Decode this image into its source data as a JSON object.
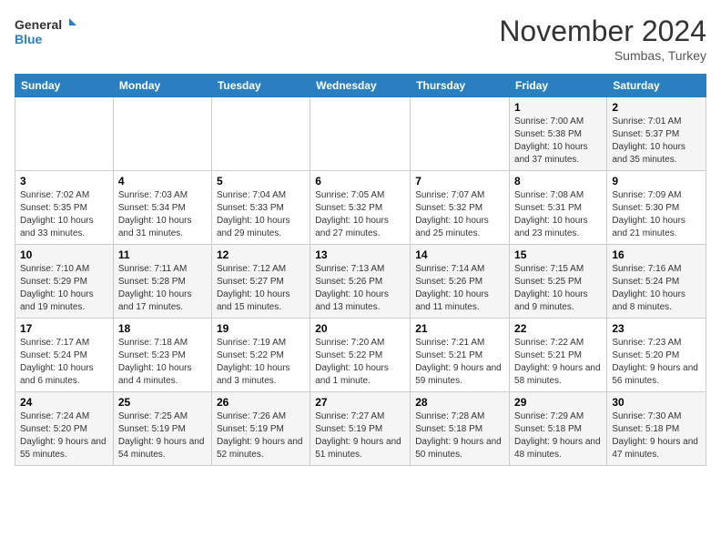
{
  "header": {
    "logo_line1": "General",
    "logo_line2": "Blue",
    "month_title": "November 2024",
    "subtitle": "Sumbas, Turkey"
  },
  "days_of_week": [
    "Sunday",
    "Monday",
    "Tuesday",
    "Wednesday",
    "Thursday",
    "Friday",
    "Saturday"
  ],
  "weeks": [
    [
      {
        "day": "",
        "info": ""
      },
      {
        "day": "",
        "info": ""
      },
      {
        "day": "",
        "info": ""
      },
      {
        "day": "",
        "info": ""
      },
      {
        "day": "",
        "info": ""
      },
      {
        "day": "1",
        "info": "Sunrise: 7:00 AM\nSunset: 5:38 PM\nDaylight: 10 hours and 37 minutes."
      },
      {
        "day": "2",
        "info": "Sunrise: 7:01 AM\nSunset: 5:37 PM\nDaylight: 10 hours and 35 minutes."
      }
    ],
    [
      {
        "day": "3",
        "info": "Sunrise: 7:02 AM\nSunset: 5:35 PM\nDaylight: 10 hours and 33 minutes."
      },
      {
        "day": "4",
        "info": "Sunrise: 7:03 AM\nSunset: 5:34 PM\nDaylight: 10 hours and 31 minutes."
      },
      {
        "day": "5",
        "info": "Sunrise: 7:04 AM\nSunset: 5:33 PM\nDaylight: 10 hours and 29 minutes."
      },
      {
        "day": "6",
        "info": "Sunrise: 7:05 AM\nSunset: 5:32 PM\nDaylight: 10 hours and 27 minutes."
      },
      {
        "day": "7",
        "info": "Sunrise: 7:07 AM\nSunset: 5:32 PM\nDaylight: 10 hours and 25 minutes."
      },
      {
        "day": "8",
        "info": "Sunrise: 7:08 AM\nSunset: 5:31 PM\nDaylight: 10 hours and 23 minutes."
      },
      {
        "day": "9",
        "info": "Sunrise: 7:09 AM\nSunset: 5:30 PM\nDaylight: 10 hours and 21 minutes."
      }
    ],
    [
      {
        "day": "10",
        "info": "Sunrise: 7:10 AM\nSunset: 5:29 PM\nDaylight: 10 hours and 19 minutes."
      },
      {
        "day": "11",
        "info": "Sunrise: 7:11 AM\nSunset: 5:28 PM\nDaylight: 10 hours and 17 minutes."
      },
      {
        "day": "12",
        "info": "Sunrise: 7:12 AM\nSunset: 5:27 PM\nDaylight: 10 hours and 15 minutes."
      },
      {
        "day": "13",
        "info": "Sunrise: 7:13 AM\nSunset: 5:26 PM\nDaylight: 10 hours and 13 minutes."
      },
      {
        "day": "14",
        "info": "Sunrise: 7:14 AM\nSunset: 5:26 PM\nDaylight: 10 hours and 11 minutes."
      },
      {
        "day": "15",
        "info": "Sunrise: 7:15 AM\nSunset: 5:25 PM\nDaylight: 10 hours and 9 minutes."
      },
      {
        "day": "16",
        "info": "Sunrise: 7:16 AM\nSunset: 5:24 PM\nDaylight: 10 hours and 8 minutes."
      }
    ],
    [
      {
        "day": "17",
        "info": "Sunrise: 7:17 AM\nSunset: 5:24 PM\nDaylight: 10 hours and 6 minutes."
      },
      {
        "day": "18",
        "info": "Sunrise: 7:18 AM\nSunset: 5:23 PM\nDaylight: 10 hours and 4 minutes."
      },
      {
        "day": "19",
        "info": "Sunrise: 7:19 AM\nSunset: 5:22 PM\nDaylight: 10 hours and 3 minutes."
      },
      {
        "day": "20",
        "info": "Sunrise: 7:20 AM\nSunset: 5:22 PM\nDaylight: 10 hours and 1 minute."
      },
      {
        "day": "21",
        "info": "Sunrise: 7:21 AM\nSunset: 5:21 PM\nDaylight: 9 hours and 59 minutes."
      },
      {
        "day": "22",
        "info": "Sunrise: 7:22 AM\nSunset: 5:21 PM\nDaylight: 9 hours and 58 minutes."
      },
      {
        "day": "23",
        "info": "Sunrise: 7:23 AM\nSunset: 5:20 PM\nDaylight: 9 hours and 56 minutes."
      }
    ],
    [
      {
        "day": "24",
        "info": "Sunrise: 7:24 AM\nSunset: 5:20 PM\nDaylight: 9 hours and 55 minutes."
      },
      {
        "day": "25",
        "info": "Sunrise: 7:25 AM\nSunset: 5:19 PM\nDaylight: 9 hours and 54 minutes."
      },
      {
        "day": "26",
        "info": "Sunrise: 7:26 AM\nSunset: 5:19 PM\nDaylight: 9 hours and 52 minutes."
      },
      {
        "day": "27",
        "info": "Sunrise: 7:27 AM\nSunset: 5:19 PM\nDaylight: 9 hours and 51 minutes."
      },
      {
        "day": "28",
        "info": "Sunrise: 7:28 AM\nSunset: 5:18 PM\nDaylight: 9 hours and 50 minutes."
      },
      {
        "day": "29",
        "info": "Sunrise: 7:29 AM\nSunset: 5:18 PM\nDaylight: 9 hours and 48 minutes."
      },
      {
        "day": "30",
        "info": "Sunrise: 7:30 AM\nSunset: 5:18 PM\nDaylight: 9 hours and 47 minutes."
      }
    ]
  ]
}
